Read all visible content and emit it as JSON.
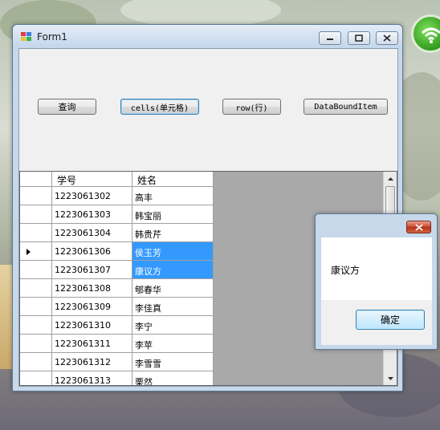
{
  "window": {
    "title": "Form1"
  },
  "buttons": {
    "query": "查询",
    "cells": "cells(单元格)",
    "row": "row(行)",
    "databound": "DataBoundItem"
  },
  "grid": {
    "columns": [
      "学号",
      "姓名"
    ],
    "current_row_index": 3,
    "selected_rows": [
      3,
      4
    ],
    "rows": [
      [
        "1223061302",
        "高丰"
      ],
      [
        "1223061303",
        "韩宝丽"
      ],
      [
        "1223061304",
        "韩贵芹"
      ],
      [
        "1223061306",
        "侯玉芳"
      ],
      [
        "1223061307",
        "康议方"
      ],
      [
        "1223061308",
        "郇春华"
      ],
      [
        "1223061309",
        "李佳真"
      ],
      [
        "1223061310",
        "李宁"
      ],
      [
        "1223061311",
        "李苹"
      ],
      [
        "1223061312",
        "李雪雪"
      ],
      [
        "1223061313",
        "栗然"
      ]
    ]
  },
  "messagebox": {
    "text": "康议方",
    "ok_label": "确定"
  },
  "colors": {
    "selection": "#3399ff",
    "grid_background": "#a9a9a9",
    "window_frame": "#c7d8ea"
  }
}
